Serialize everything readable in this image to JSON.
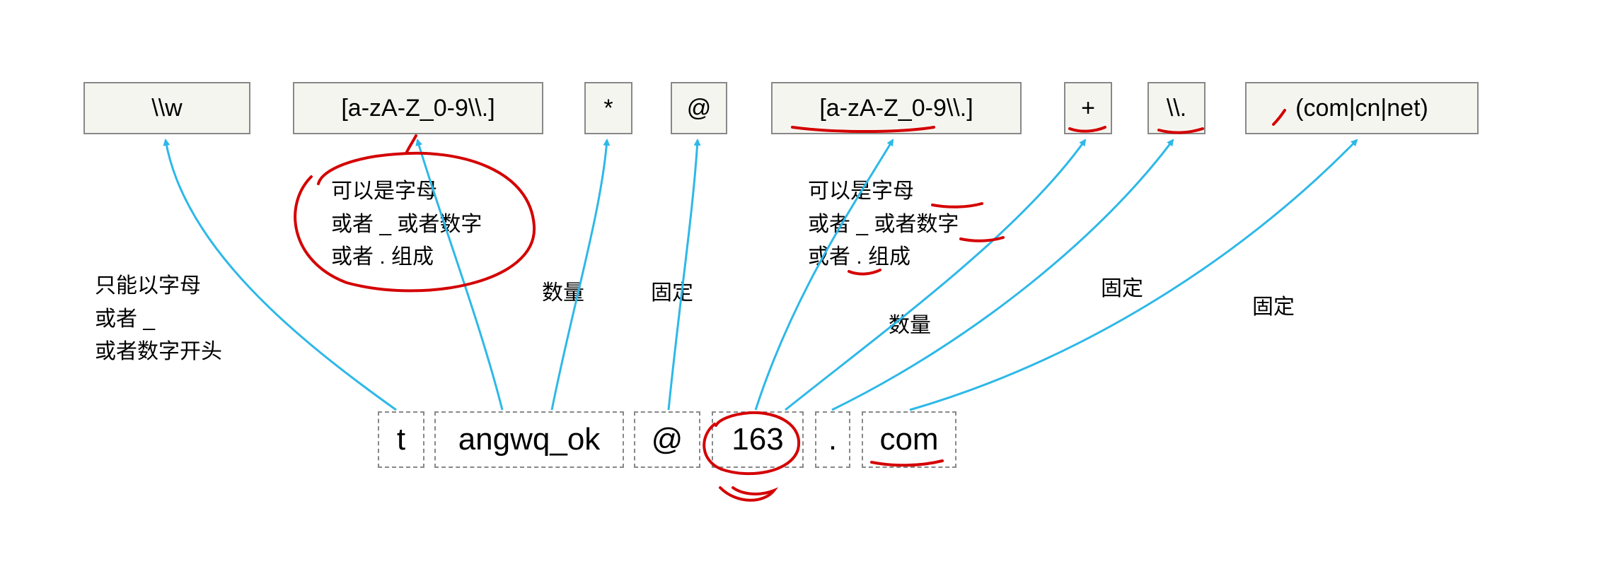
{
  "regex_boxes": {
    "w": "\\\\w",
    "charclass1": "[a-zA-Z_0-9\\\\.]",
    "star": "*",
    "at": "@",
    "charclass2": "[a-zA-Z_0-9\\\\.]",
    "plus": "+",
    "escdot": "\\\\.",
    "group": "(com|cn|net)"
  },
  "email_parts": {
    "p1": "t",
    "p2": "angwq_ok",
    "p3": "@",
    "p4": "163",
    "p5": ".",
    "p6": "com"
  },
  "notes": {
    "n1": "只能以字母\n或者 _\n或者数字开头",
    "n2": "可以是字母\n或者 _ 或者数字\n或者 . 组成",
    "n3": "数量",
    "n4": "固定",
    "n5": "可以是字母\n或者 _ 或者数字\n或者 . 组成",
    "n6": "数量",
    "n7": "固定",
    "n8": "固定"
  },
  "colors": {
    "arrow": "#2db8e8",
    "annotation": "#d40000"
  }
}
